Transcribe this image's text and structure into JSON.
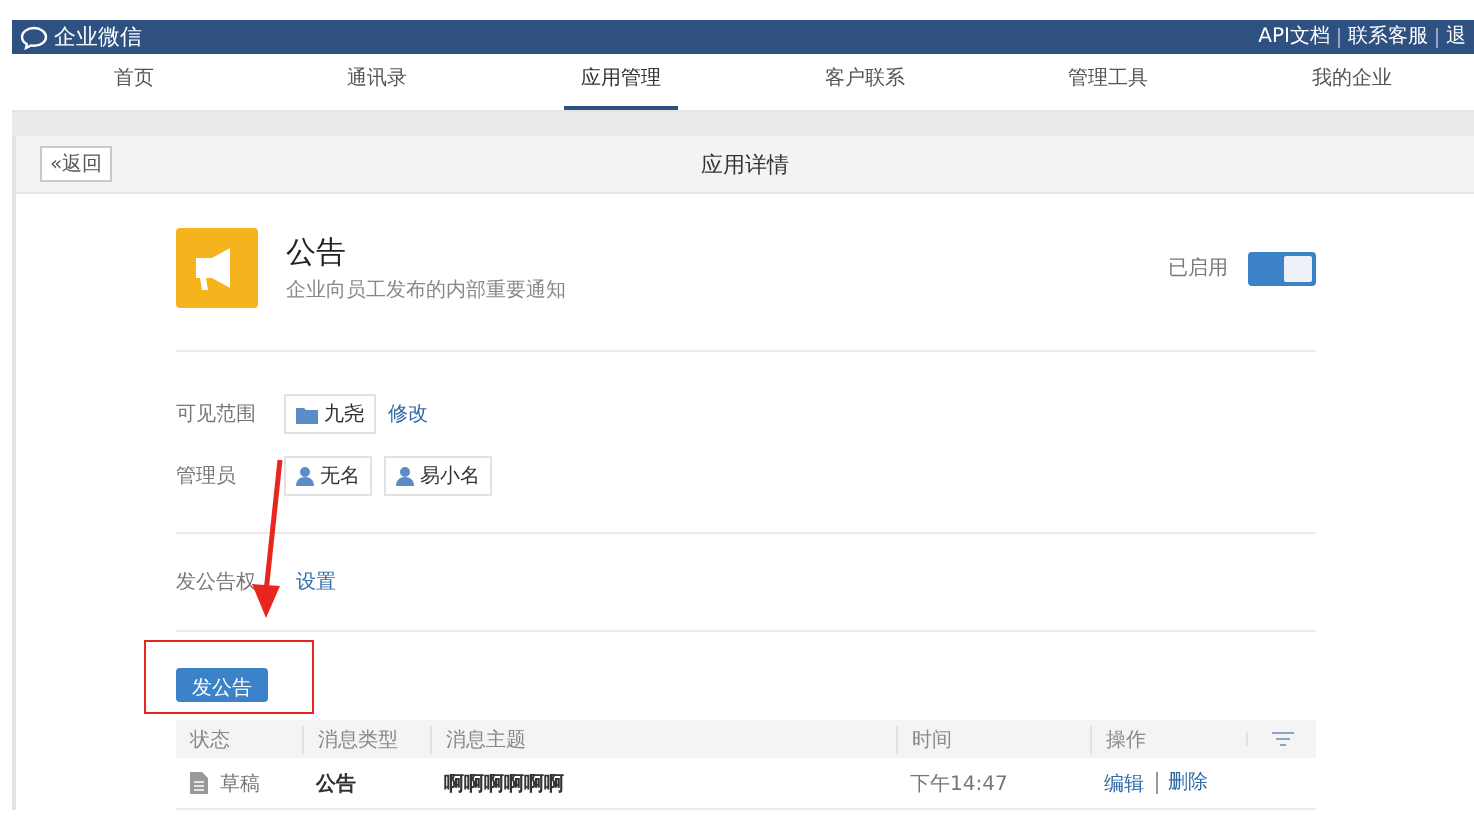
{
  "header": {
    "logo": "企业微信",
    "links": [
      "API文档",
      "联系客服",
      "退"
    ]
  },
  "nav": [
    {
      "label": "首页",
      "selected": false
    },
    {
      "label": "通讯录",
      "selected": false
    },
    {
      "label": "应用管理",
      "selected": true
    },
    {
      "label": "客户联系",
      "selected": false
    },
    {
      "label": "管理工具",
      "selected": false
    },
    {
      "label": "我的企业",
      "selected": false
    }
  ],
  "panel": {
    "back_button": "«返回",
    "title": "应用详情"
  },
  "app": {
    "name": "公告",
    "description": "企业向员工发布的内部重要通知",
    "status_label": "已启用",
    "enabled": true
  },
  "fields": [
    {
      "label": "可见范围",
      "chips": [
        {
          "kind": "department",
          "label": "九尧"
        }
      ],
      "link": "修改"
    },
    {
      "label": "管理员",
      "chips": [
        {
          "kind": "person",
          "label": "无名"
        },
        {
          "kind": "person",
          "label": "易小名"
        }
      ]
    }
  ],
  "permission": {
    "label": "发公告权",
    "link": "设置"
  },
  "publish_button": "发公告",
  "table": {
    "columns": [
      "状态",
      "消息类型",
      "消息主题",
      "时间",
      "操作"
    ],
    "rows": [
      {
        "status": "草稿",
        "type": "公告",
        "subject": "啊啊啊啊啊啊",
        "time": "下午14:47",
        "actions": [
          "编辑",
          "删除"
        ]
      }
    ]
  }
}
